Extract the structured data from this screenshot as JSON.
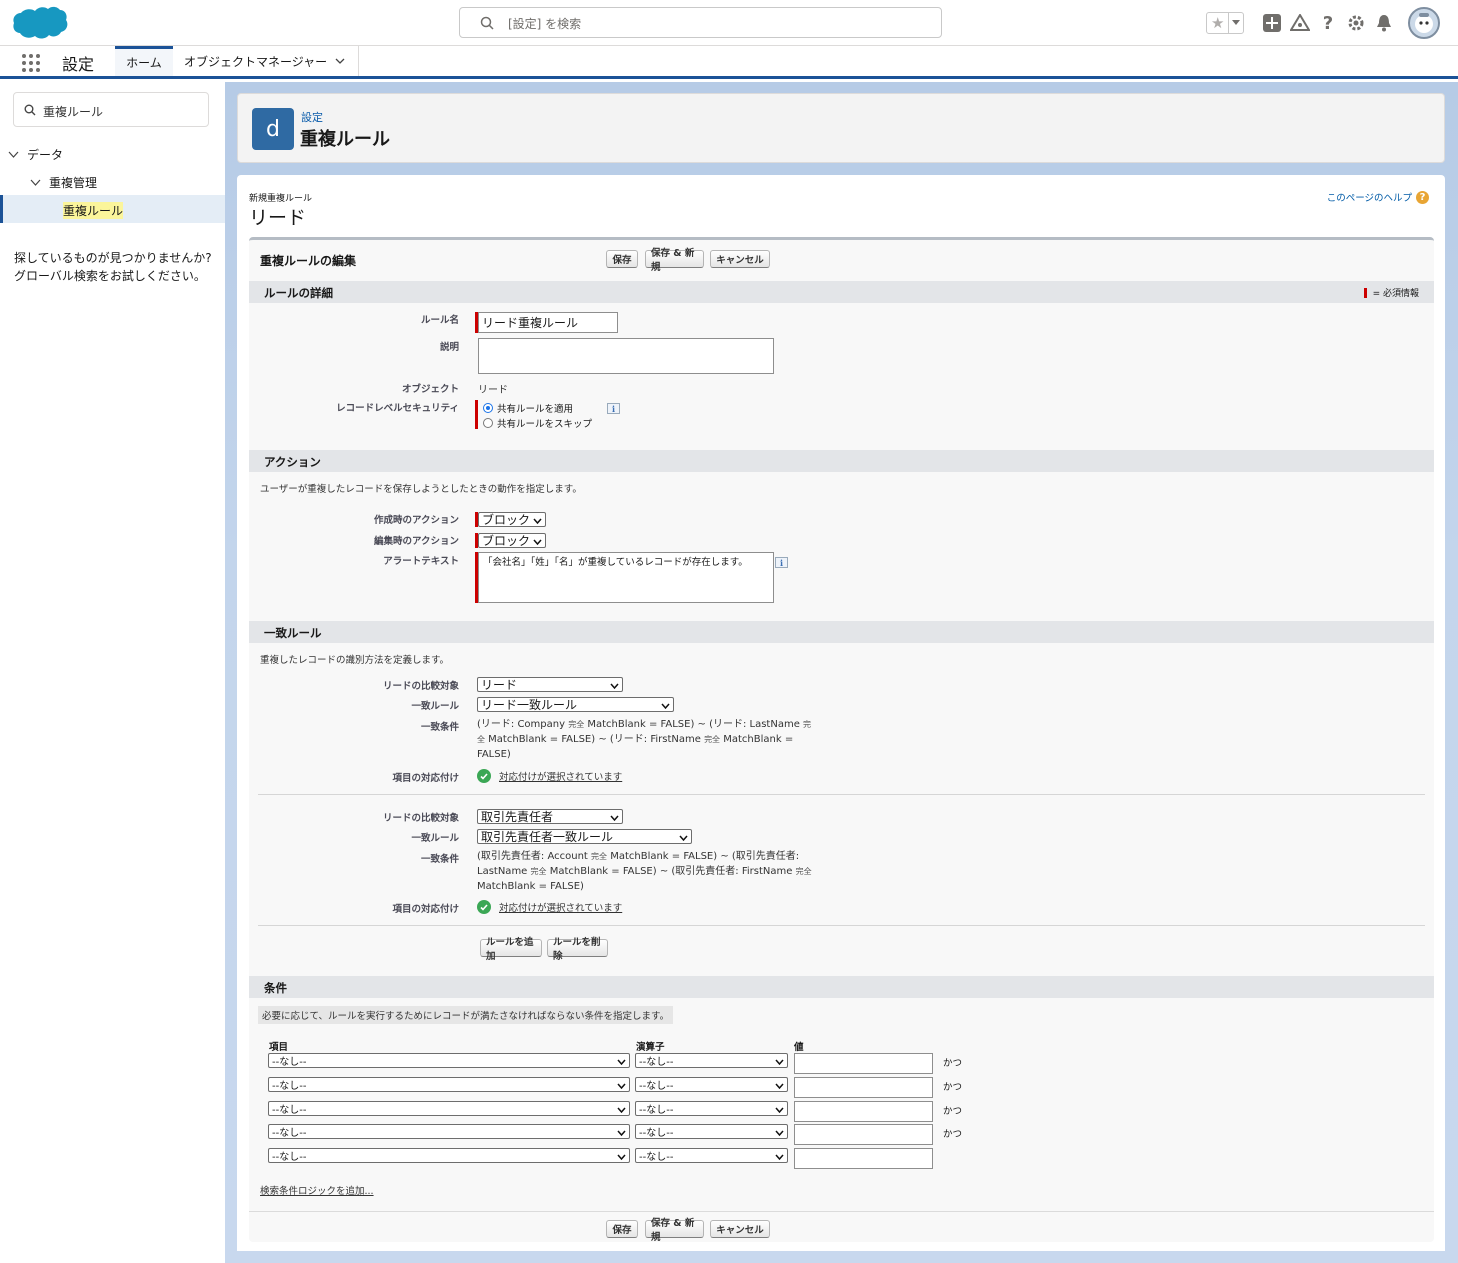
{
  "header": {
    "search_placeholder": "[設定] を検索"
  },
  "nav": {
    "app_name": "設定",
    "tabs": [
      {
        "label": "ホーム"
      },
      {
        "label": "オブジェクトマネージャー"
      }
    ]
  },
  "sidebar": {
    "quickfind_value": "重複ルール",
    "tree": {
      "level1": "データ",
      "level2": "重複管理",
      "level3": "重複ルール"
    },
    "not_found_line1": "探しているものが見つかりませんか?",
    "not_found_line2": "グローバル検索をお試しください。"
  },
  "page_header": {
    "icon_letter": "d",
    "breadcrumb": "設定",
    "title": "重複ルール"
  },
  "content": {
    "subtitle": "新規重複ルール",
    "title": "リード",
    "help_link": "このページのヘルプ",
    "block_title": "重複ルールの編集",
    "buttons": {
      "save": "保存",
      "save_new": "保存 & 新規",
      "cancel": "キャンセル"
    },
    "required_legend": "= 必須情報",
    "rule_details": {
      "section_title": "ルールの詳細",
      "rule_name_label": "ルール名",
      "rule_name_value": "リード重複ルール",
      "description_label": "説明",
      "description_value": "",
      "object_label": "オブジェクト",
      "object_value": "リード",
      "security_label": "レコードレベルセキュリティ",
      "security_option1": "共有ルールを適用",
      "security_option2": "共有ルールをスキップ",
      "security_selected": 1
    },
    "actions": {
      "section_title": "アクション",
      "description": "ユーザーが重複したレコードを保存しようとしたときの動作を指定します。",
      "on_create_label": "作成時のアクション",
      "on_create_value": "ブロック",
      "on_edit_label": "編集時のアクション",
      "on_edit_value": "ブロック",
      "alert_label": "アラートテキスト",
      "alert_value": "「会社名」「姓」「名」が重複しているレコードが存在します。"
    },
    "matching": {
      "section_title": "一致ルール",
      "description": "重複したレコードの識別方法を定義します。",
      "compare_label": "リードの比較対象",
      "rule_label": "一致ルール",
      "criteria_label": "一致条件",
      "mapping_label": "項目の対応付け",
      "rules": [
        {
          "compare_value": "リード",
          "rule_value": "リード一致ルール",
          "criteria_l1a": "(リード: Company ",
          "criteria_l1b": "完全",
          "criteria_l1c": " MatchBlank = FALSE) ~ (リード: LastName ",
          "criteria_l1d": "完",
          "criteria_l2a": "全",
          "criteria_l2b": " MatchBlank = FALSE) ~ (リード: FirstName ",
          "criteria_l2c": "完全",
          "criteria_l2d": " MatchBlank =",
          "criteria_l3": "FALSE)",
          "mapping_text": "対応付けが選択されています"
        },
        {
          "compare_value": "取引先責任者",
          "rule_value": "取引先責任者一致ルール",
          "criteria_l1a": "(取引先責任者: Account ",
          "criteria_l1b": "完全",
          "criteria_l1c": " MatchBlank = FALSE) ~ (取引先責任者:",
          "criteria_l2a": "LastName ",
          "criteria_l2b": "完全",
          "criteria_l2c": " MatchBlank = FALSE) ~ (取引先責任者: FirstName ",
          "criteria_l2d": "完全",
          "criteria_l3": "MatchBlank = FALSE)",
          "mapping_text": "対応付けが選択されています"
        }
      ],
      "add_rule": "ルールを追加",
      "remove_rule": "ルールを削除"
    },
    "conditions": {
      "section_title": "条件",
      "description": "必要に応じて、ルールを実行するためにレコードが満たさなければならない条件を指定します。",
      "col_field": "項目",
      "col_operator": "演算子",
      "col_value": "値",
      "none_option": "--なし--",
      "and_label": "かつ",
      "logic_link": "検索条件ロジックを追加..."
    }
  }
}
